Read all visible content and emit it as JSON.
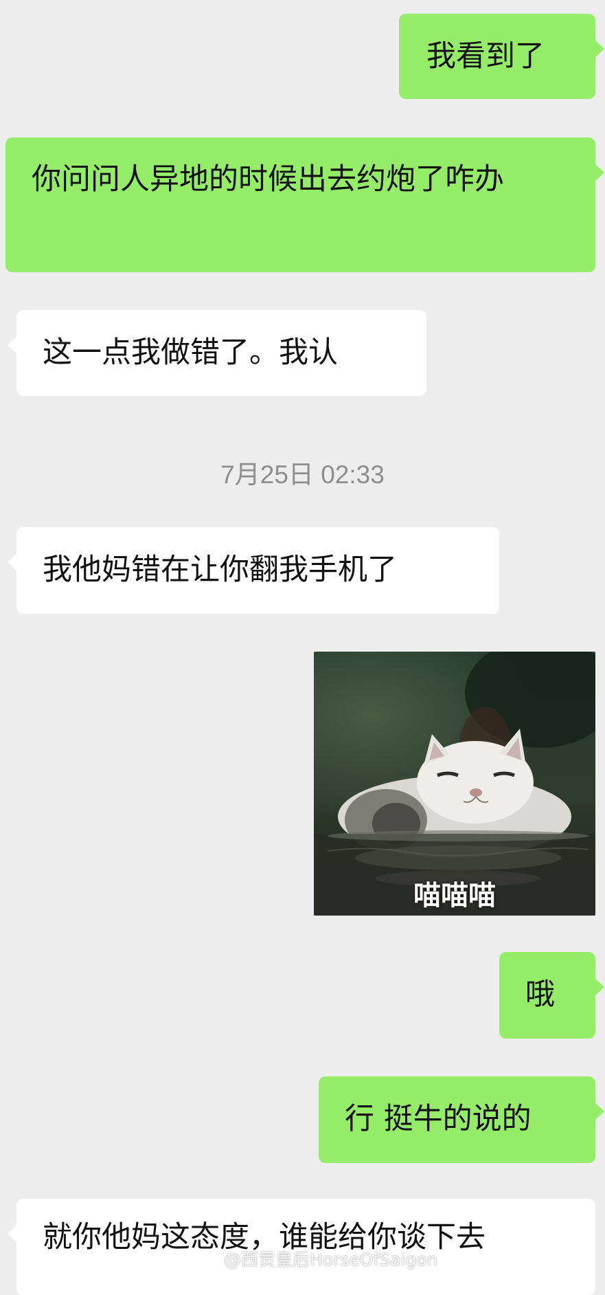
{
  "messages": [
    {
      "text": "我看到了"
    },
    {
      "text": "你问问人异地的时候出去约炮了咋办"
    },
    {
      "text": "这一点我做错了。我认"
    },
    {
      "text": "我他妈错在让你翻我手机了"
    },
    {
      "text": "哦"
    },
    {
      "text": "行 挺牛的说的"
    },
    {
      "text": "就你他妈这态度，谁能给你谈下去"
    }
  ],
  "timestamp": "7月25日 02:33",
  "sticker": {
    "caption": "喵喵喵",
    "icon": "cat-in-water-sticker"
  },
  "watermark": {
    "text": "@西贡皇后HorseOfSaigon",
    "icon": "weibo-logo-icon"
  },
  "colors": {
    "background": "#ededed",
    "sent_bubble": "#95ec69",
    "received_bubble": "#ffffff"
  }
}
